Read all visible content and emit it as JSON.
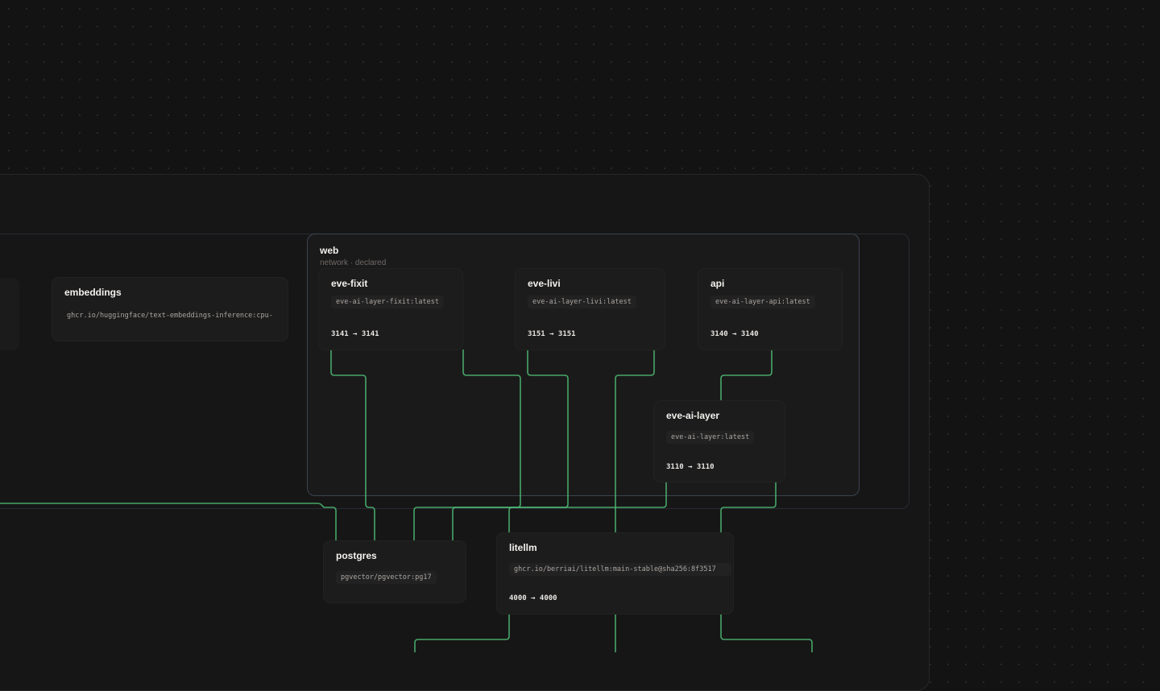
{
  "network": {
    "name": "web",
    "subtitle": "network · declared"
  },
  "nodes": {
    "embeddings": {
      "name": "embeddings",
      "image": "ghcr.io/huggingface/text-embeddings-inference:cpu-"
    },
    "eve_fixit": {
      "name": "eve-fixit",
      "image": "eve-ai-layer-fixit:latest",
      "ports": "3141 → 3141"
    },
    "eve_livi": {
      "name": "eve-livi",
      "image": "eve-ai-layer-livi:latest",
      "ports": "3151 → 3151"
    },
    "api": {
      "name": "api",
      "image": "eve-ai-layer-api:latest",
      "ports": "3140 → 3140"
    },
    "eve_ai_layer": {
      "name": "eve-ai-layer",
      "image": "eve-ai-layer:latest",
      "ports": "3110 → 3110"
    },
    "postgres": {
      "name": "postgres",
      "image": "pgvector/pgvector:pg17"
    },
    "litellm": {
      "name": "litellm",
      "image": "ghcr.io/berriai/litellm:main-stable@sha256:8f3517",
      "ports": "4000 → 4000"
    }
  },
  "colors": {
    "background": "#141313",
    "edge": "#4fbf78",
    "network_border": "#3a4452"
  }
}
